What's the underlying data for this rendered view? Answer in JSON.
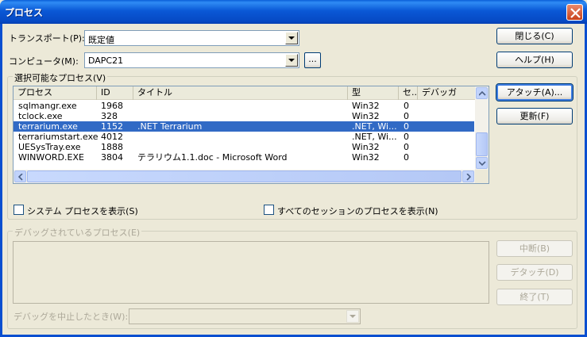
{
  "window": {
    "title": "プロセス"
  },
  "transport": {
    "label": "トランスポート",
    "accel": "(P):",
    "value": "既定値"
  },
  "computer": {
    "label": "コンピュータ",
    "accel": "(M):",
    "value": "DAPC21",
    "browse_label": "..."
  },
  "buttons": {
    "close": "閉じる(C)",
    "help": "ヘルプ(H)",
    "attach": "アタッチ(A)...",
    "refresh": "更新(F)",
    "break": "中断(B)",
    "detach": "デタッチ(D)",
    "terminate": "終了(T)"
  },
  "available": {
    "group_label": "選択可能なプロセス(V)",
    "columns": [
      "プロセス",
      "ID",
      "タイトル",
      "型",
      "セ..",
      "デバッガ"
    ],
    "rows": [
      {
        "process": "sqlmangr.exe",
        "id": "1968",
        "title": "",
        "type": "Win32",
        "session": "0"
      },
      {
        "process": "tclock.exe",
        "id": "328",
        "title": "",
        "type": "Win32",
        "session": "0"
      },
      {
        "process": "terrarium.exe",
        "id": "1152",
        "title": ".NET Terrarium",
        "type": ".NET, Wi...",
        "session": "0",
        "selected": true
      },
      {
        "process": "terrariumstart.exe",
        "id": "4012",
        "title": "",
        "type": ".NET, Wi...",
        "session": "0"
      },
      {
        "process": "UESysTray.exe",
        "id": "1888",
        "title": "",
        "type": "Win32",
        "session": "0"
      },
      {
        "process": "WINWORD.EXE",
        "id": "3804",
        "title": "テラリウム1.1.doc - Microsoft Word",
        "type": "Win32",
        "session": "0"
      }
    ],
    "show_system_label": "システム プロセスを表示(S)",
    "show_all_sessions_label": "すべてのセッションのプロセスを表示(N)"
  },
  "debugged": {
    "group_label": "デバッグされているプロセス(E)",
    "on_stop_label": "デバッグを中止したとき(W):"
  }
}
